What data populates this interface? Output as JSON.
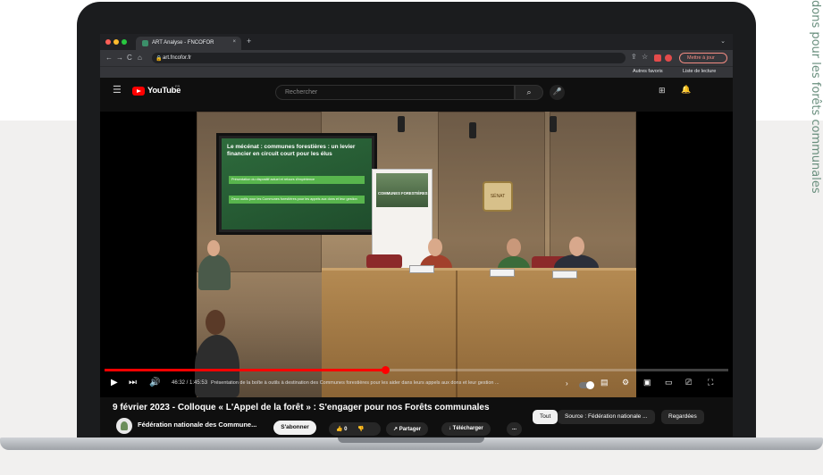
{
  "page": {
    "side_text": "dons pour les forêts communales"
  },
  "browser": {
    "tab_title": "ART Analyse - FNCOFOR",
    "tab_close": "×",
    "new_tab": "+",
    "url": "art.fncofor.fr",
    "update_button": "Mettre à jour",
    "bookmarks": {
      "other": "Autres favoris",
      "reading_list": "Liste de lecture"
    },
    "nav": {
      "back": "←",
      "forward": "→",
      "reload": "C",
      "home": "⌂"
    }
  },
  "youtube": {
    "brand": "YouTube",
    "region": "FR",
    "search_placeholder": "Rechercher",
    "player": {
      "progress_fraction": 0.45,
      "time": "46:32 / 1:45:53",
      "chapter": "Présentation de la boîte à outils à destination des Communes forestières pour les aider dans leurs appels aux dons et leur gestion ...",
      "slide_title": "Le mécénat : communes forestières : un levier financier en circuit court pour les élus",
      "slide_box_1": "Présentation du dispositif actuel et retours d'expérience",
      "slide_box_2": "Deux outils pour les Communes forestières pour les appels aux dons et leur gestion",
      "banner_title": "COMMUNES FORESTIÈRES",
      "seal_text": "SÉNAT"
    },
    "video_title": "9 février 2023 - Colloque « L'Appel de la forêt » : S'engager pour nos Forêts communales",
    "channel_name": "Fédération nationale des Commune...",
    "subscribe_label": "S'abonner",
    "like_count": "0",
    "share_label": "Partager",
    "download_label": "Télécharger",
    "more_label": "...",
    "chips": {
      "all": "Tout",
      "source": "Source : Fédération nationale ...",
      "watched": "Regardées"
    }
  },
  "colors": {
    "accent": "#ff0000",
    "dark_bg": "#0f0f0f",
    "side_text": "#6a8f7e"
  }
}
